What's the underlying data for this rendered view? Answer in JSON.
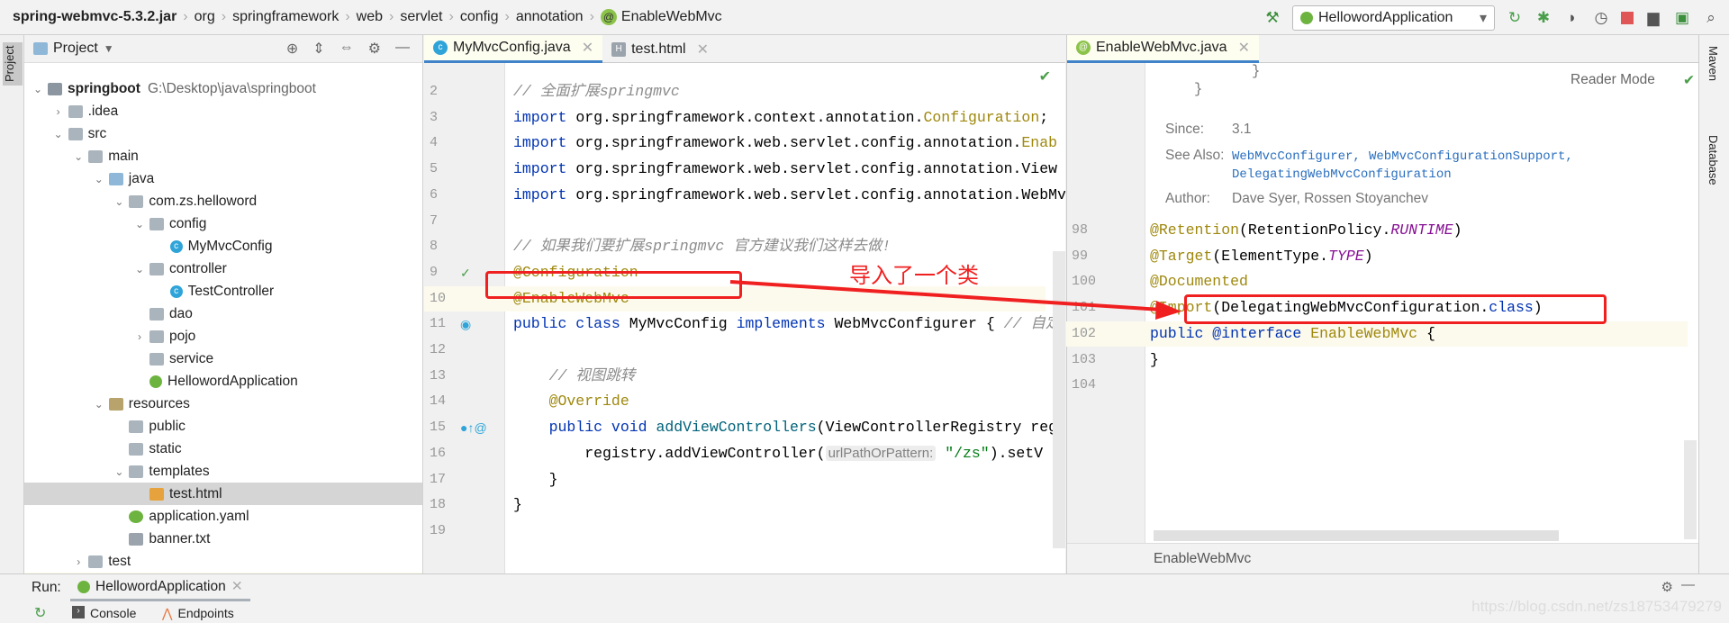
{
  "breadcrumb": [
    "spring-webmvc-5.3.2.jar",
    "org",
    "springframework",
    "web",
    "servlet",
    "config",
    "annotation",
    "EnableWebMvc"
  ],
  "toolbar": {
    "run_config": "HellowordApplication"
  },
  "left_strip": {
    "project_label": "Project"
  },
  "project": {
    "title": "Project",
    "items": [
      {
        "label": "springboot",
        "path": "G:\\Desktop\\java\\springboot",
        "depth": 0,
        "arrow": "v",
        "icon": "module"
      },
      {
        "label": ".idea",
        "depth": 1,
        "arrow": ">",
        "icon": "idea"
      },
      {
        "label": "src",
        "depth": 1,
        "arrow": "v",
        "icon": "folder"
      },
      {
        "label": "main",
        "depth": 2,
        "arrow": "v",
        "icon": "folder"
      },
      {
        "label": "java",
        "depth": 3,
        "arrow": "v",
        "icon": "src"
      },
      {
        "label": "com.zs.helloword",
        "depth": 4,
        "arrow": "v",
        "icon": "pkg"
      },
      {
        "label": "config",
        "depth": 5,
        "arrow": "v",
        "icon": "pkg"
      },
      {
        "label": "MyMvcConfig",
        "depth": 6,
        "arrow": "",
        "icon": "class"
      },
      {
        "label": "controller",
        "depth": 5,
        "arrow": "v",
        "icon": "pkg"
      },
      {
        "label": "TestController",
        "depth": 6,
        "arrow": "",
        "icon": "class"
      },
      {
        "label": "dao",
        "depth": 5,
        "arrow": "",
        "icon": "pkg"
      },
      {
        "label": "pojo",
        "depth": 5,
        "arrow": ">",
        "icon": "pkg"
      },
      {
        "label": "service",
        "depth": 5,
        "arrow": "",
        "icon": "pkg"
      },
      {
        "label": "HellowordApplication",
        "depth": 5,
        "arrow": "",
        "icon": "spring"
      },
      {
        "label": "resources",
        "depth": 3,
        "arrow": "v",
        "icon": "res"
      },
      {
        "label": "public",
        "depth": 4,
        "arrow": "",
        "icon": "folder"
      },
      {
        "label": "static",
        "depth": 4,
        "arrow": "",
        "icon": "folder"
      },
      {
        "label": "templates",
        "depth": 4,
        "arrow": "v",
        "icon": "folder"
      },
      {
        "label": "test.html",
        "depth": 5,
        "arrow": "",
        "icon": "html",
        "selected": true
      },
      {
        "label": "application.yaml",
        "depth": 4,
        "arrow": "",
        "icon": "yaml"
      },
      {
        "label": "banner.txt",
        "depth": 4,
        "arrow": "",
        "icon": "txt"
      },
      {
        "label": "test",
        "depth": 2,
        "arrow": ">",
        "icon": "folder"
      }
    ]
  },
  "editor_left": {
    "tabs": [
      {
        "label": "MyMvcConfig.java",
        "active": true
      },
      {
        "label": "test.html",
        "active": false
      }
    ],
    "current_line": 10,
    "lines": [
      {
        "n": 2,
        "t": [
          [
            "// 全面扩展springmvc",
            "c"
          ]
        ]
      },
      {
        "n": 3,
        "t": [
          [
            "import",
            "k"
          ],
          [
            " org.springframework.context.annotation.",
            ""
          ],
          [
            "Configuration",
            "a"
          ],
          [
            ";",
            ""
          ]
        ]
      },
      {
        "n": 4,
        "t": [
          [
            "import",
            "k"
          ],
          [
            " org.springframework.web.servlet.config.annotation.",
            ""
          ],
          [
            "Enab",
            "a"
          ]
        ]
      },
      {
        "n": 5,
        "t": [
          [
            "import",
            "k"
          ],
          [
            " org.springframework.web.servlet.config.annotation.View",
            ""
          ]
        ]
      },
      {
        "n": 6,
        "t": [
          [
            "import",
            "k"
          ],
          [
            " org.springframework.web.servlet.config.annotation.WebMv",
            ""
          ]
        ]
      },
      {
        "n": 7,
        "t": []
      },
      {
        "n": 8,
        "t": [
          [
            "// 如果我们要扩展springmvc 官方建议我们这样去做!",
            "c"
          ]
        ]
      },
      {
        "n": 9,
        "t": [
          [
            "@Configuration",
            "a"
          ]
        ]
      },
      {
        "n": 10,
        "t": [
          [
            "@EnableWebMvc",
            "a"
          ]
        ]
      },
      {
        "n": 11,
        "t": [
          [
            "public class",
            "k"
          ],
          [
            " MyMvcConfig ",
            ""
          ],
          [
            "implements",
            "k"
          ],
          [
            " WebMvcConfigurer { ",
            ""
          ],
          [
            "// 自定",
            "c"
          ]
        ]
      },
      {
        "n": 12,
        "t": []
      },
      {
        "n": 13,
        "t": [
          [
            "    // 视图跳转",
            "c"
          ]
        ]
      },
      {
        "n": 14,
        "t": [
          [
            "    @Override",
            "a"
          ]
        ]
      },
      {
        "n": 15,
        "t": [
          [
            "    public void ",
            "k"
          ],
          [
            "addViewControllers",
            "m"
          ],
          [
            "(ViewControllerRegistry reg",
            ""
          ]
        ]
      },
      {
        "n": 16,
        "t": [
          [
            "        registry.addViewController(",
            ""
          ],
          [
            "urlPathOrPattern:",
            "hint"
          ],
          [
            " ",
            ""
          ],
          [
            "\"/zs\"",
            "s"
          ],
          [
            ").setV",
            ""
          ]
        ]
      },
      {
        "n": 17,
        "t": [
          [
            "    }",
            ""
          ]
        ]
      },
      {
        "n": 18,
        "t": [
          [
            "}",
            ""
          ]
        ]
      },
      {
        "n": 19,
        "t": []
      }
    ]
  },
  "editor_right": {
    "tabs": [
      {
        "label": "EnableWebMvc.java",
        "active": true
      }
    ],
    "reader_mode": "Reader Mode",
    "doc": {
      "since_label": "Since:",
      "since": "3.1",
      "see_also_label": "See Also:",
      "see_also": [
        "WebMvcConfigurer,",
        "WebMvcConfigurationSupport,",
        "DelegatingWebMvcConfiguration"
      ],
      "author_label": "Author:",
      "author": "Dave Syer, Rossen Stoyanchev"
    },
    "current_line": 102,
    "lines": [
      {
        "n": 98,
        "t": [
          [
            "@Retention",
            "a"
          ],
          [
            "(RetentionPolicy.",
            ""
          ],
          [
            "RUNTIME",
            "f"
          ],
          [
            ")",
            ""
          ]
        ]
      },
      {
        "n": 99,
        "t": [
          [
            "@Target",
            "a"
          ],
          [
            "(ElementType.",
            ""
          ],
          [
            "TYPE",
            "f"
          ],
          [
            ")",
            ""
          ]
        ]
      },
      {
        "n": 100,
        "t": [
          [
            "@Documented",
            "a"
          ]
        ]
      },
      {
        "n": 101,
        "t": [
          [
            "@Import",
            "a"
          ],
          [
            "(DelegatingWebMvcConfiguration.",
            ""
          ],
          [
            "class",
            "k"
          ],
          [
            ")",
            ""
          ]
        ]
      },
      {
        "n": 102,
        "t": [
          [
            "public @interface",
            "k"
          ],
          [
            " ",
            ""
          ],
          [
            "EnableWebMvc",
            "a"
          ],
          [
            " {",
            ""
          ]
        ]
      },
      {
        "n": 103,
        "t": [
          [
            "}",
            ""
          ]
        ]
      },
      {
        "n": 104,
        "t": []
      }
    ],
    "breadcrumb": "EnableWebMvc"
  },
  "right_strip": {
    "maven": "Maven",
    "database": "Database"
  },
  "annotation": {
    "text": "导入了一个类",
    "color": "#f02020"
  },
  "run": {
    "label": "Run:",
    "tab": "HellowordApplication",
    "console": "Console",
    "endpoints": "Endpoints"
  },
  "watermark": "https://blog.csdn.net/zs18753479279"
}
